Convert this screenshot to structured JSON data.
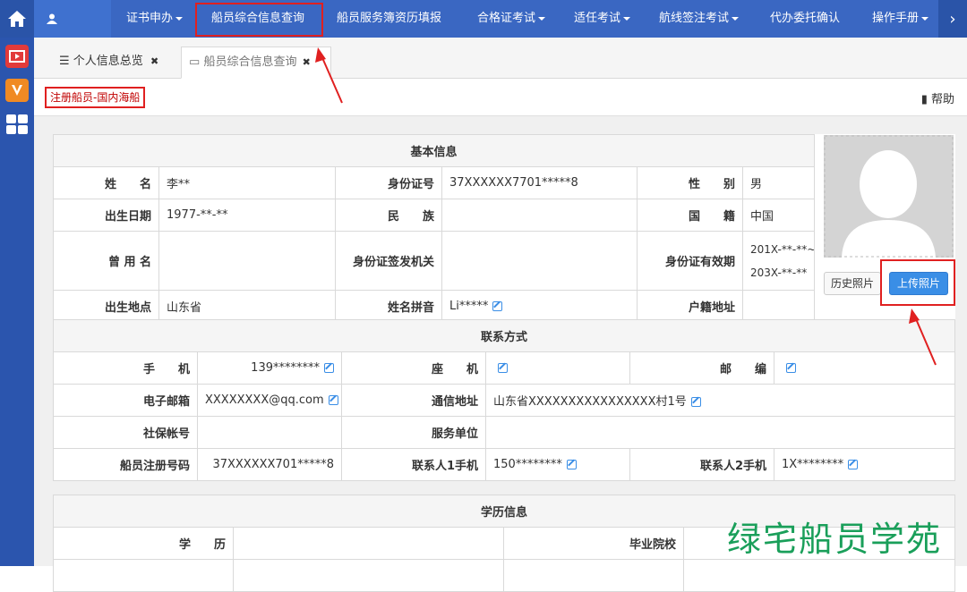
{
  "nav": {
    "user_name": "",
    "items": [
      {
        "label": "证书申办",
        "caret": true
      },
      {
        "label": "船员综合信息查询",
        "caret": false
      },
      {
        "label": "船员服务簿资历填报",
        "caret": false
      },
      {
        "label": "合格证考试",
        "caret": true
      },
      {
        "label": "适任考试",
        "caret": true
      },
      {
        "label": "航线签注考试",
        "caret": true
      },
      {
        "label": "代办委托确认",
        "caret": false
      },
      {
        "label": "操作手册",
        "caret": true
      }
    ]
  },
  "tabs": [
    {
      "label": "个人信息总览",
      "close": "✖"
    },
    {
      "label": "船员综合信息查询",
      "close": "✖"
    }
  ],
  "subbar": {
    "badge": "注册船员-国内海船",
    "help": "帮助"
  },
  "basic": {
    "title": "基本信息",
    "name_label": "姓　　名",
    "name": "李**",
    "id_label": "身份证号",
    "id": "37XXXXXX7701*****8",
    "sex_label": "性　　别",
    "sex": "男",
    "birth_label": "出生日期",
    "birth": "1977-**-**",
    "ethnic_label": "民　　族",
    "ethnic": "",
    "nation_label": "国　　籍",
    "nation": "中国",
    "alias_label": "曾 用 名",
    "alias": "",
    "issuer_label": "身份证签发机关",
    "issuer": "",
    "validity_label": "身份证有效期",
    "validity_1": "201X-**-**~",
    "validity_2": "203X-**-**",
    "birthplace_label": "出生地点",
    "birthplace": "山东省",
    "pinyin_label": "姓名拼音",
    "pinyin": "Li*****",
    "hukou_label": "户籍地址",
    "hukou": "",
    "history_btn": "历史照片",
    "upload_btn": "上传照片"
  },
  "contact": {
    "title": "联系方式",
    "mobile_label": "手　　机",
    "mobile": "139********",
    "phone_label": "座　　机",
    "phone": "",
    "zip_label": "邮　　编",
    "zip": "",
    "email_label": "电子邮箱",
    "email": "XXXXXXXX@qq.com",
    "address_label": "通信地址",
    "address": "山东省XXXXXXXXXXXXXXXX村1号",
    "social_label": "社保帐号",
    "social": "",
    "employer_label": "服务单位",
    "employer": "",
    "reg_label": "船员注册号码",
    "reg": "37XXXXXX701*****8",
    "c1_label": "联系人1手机",
    "c1": "150********",
    "c2_label": "联系人2手机",
    "c2": "1X********"
  },
  "education": {
    "title": "学历信息",
    "degree_label": "学　　历",
    "degree": "",
    "school_label": "毕业院校",
    "school": ""
  },
  "watermark": "绿宅船员学苑",
  "colors": {
    "nav": "#3a67c2",
    "accent": "#3a8ee6",
    "annotation": "#e02020",
    "watermark": "#1a9f5a"
  }
}
